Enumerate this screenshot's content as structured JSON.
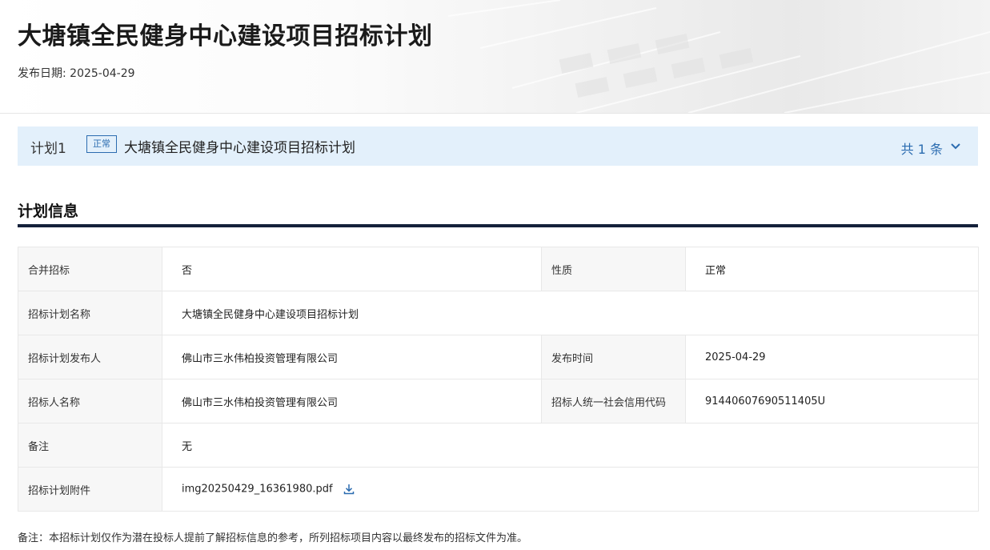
{
  "header": {
    "title": "大塘镇全民健身中心建设项目招标计划",
    "publish_label": "发布日期:",
    "publish_date": "2025-04-29"
  },
  "plan_bar": {
    "label": "计划1",
    "badge": "正常",
    "name": "大塘镇全民健身中心建设项目招标计划",
    "count": "共 1 条",
    "badge_color": "#2b6cb0",
    "background": "#e3f0fb"
  },
  "section": {
    "title": "计划信息"
  },
  "info": {
    "merged_label": "合并招标",
    "merged_value": "否",
    "nature_label": "性质",
    "nature_value": "正常",
    "plan_name_label": "招标计划名称",
    "plan_name_value": "大塘镇全民健身中心建设项目招标计划",
    "publisher_label": "招标计划发布人",
    "publisher_value": "佛山市三水伟柏投资管理有限公司",
    "publish_time_label": "发布时间",
    "publish_time_value": "2025-04-29",
    "tenderer_label": "招标人名称",
    "tenderer_value": "佛山市三水伟柏投资管理有限公司",
    "credit_code_label": "招标人统一社会信用代码",
    "credit_code_value": "91440607690511405U",
    "remark_label": "备注",
    "remark_value": "无",
    "attachment_label": "招标计划附件",
    "attachment_value": "img20250429_16361980.pdf",
    "attachment_icon": "download-icon"
  },
  "footnote": "备注：本招标计划仅作为潜在投标人提前了解招标信息的参考，所列招标项目内容以最终发布的招标文件为准。"
}
